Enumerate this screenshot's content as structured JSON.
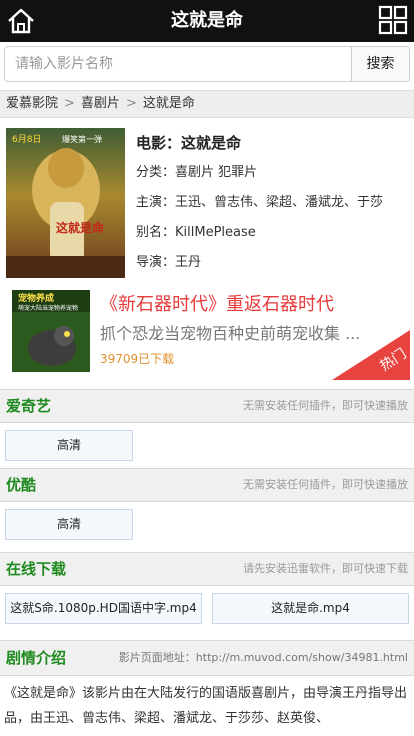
{
  "header": {
    "title": "这就是命",
    "home_icon": "home-icon",
    "menu_icon": "grid-menu-icon"
  },
  "search": {
    "placeholder": "请输入影片名称",
    "button_label": "搜索"
  },
  "breadcrumb": {
    "items": [
      "爱慕影院",
      "喜剧片",
      "这就是命"
    ],
    "separator": ">"
  },
  "movie": {
    "poster_text": {
      "top": "6月8日",
      "tag": "爆笑第一弹",
      "title": "这就是命"
    },
    "title": "电影：这就是命",
    "genre": "分类：喜剧片 犯罪片",
    "cast": "主演：王迅、曾志伟、梁超、潘斌龙、于莎",
    "alias": "别名：KillMePlease",
    "director": "导演：王丹"
  },
  "ad": {
    "thumb_title": "宠物养成",
    "thumb_sub": "萌宠大陆当宠物养宠物",
    "headline": "《新石器时代》重返石器时代",
    "description": "抓个恐龙当宠物百种史前萌宠收集 ...",
    "downloads": "39709已下载",
    "badge": "热门"
  },
  "sources": [
    {
      "name": "爱奇艺",
      "tip": "无需安装任何插件，即可快速播放",
      "links": [
        "高清"
      ]
    },
    {
      "name": "优酷",
      "tip": "无需安装任何插件，即可快速播放",
      "links": [
        "高清"
      ]
    },
    {
      "name": "在线下载",
      "tip": "请先安装迅雷软件，即可快速下载",
      "links": [
        "这就S命.1080p.HD国语中字.mp4",
        "这就是命.mp4"
      ]
    }
  ],
  "plot": {
    "name": "剧情介绍",
    "page_url": "影片页面地址：http://m.muvod.com/show/34981.html",
    "text": "《这就是命》该影片由在大陆发行的国语版喜剧片，由导演王丹指导出品，由王迅、曾志伟、梁超、潘斌龙、于莎莎、赵英俊、"
  },
  "colors": {
    "topbar": "#111111",
    "section_title": "#1f8a1f",
    "ad_headline": "#e53b3b",
    "badge": "#e8443f",
    "downloads": "#e0912c"
  }
}
